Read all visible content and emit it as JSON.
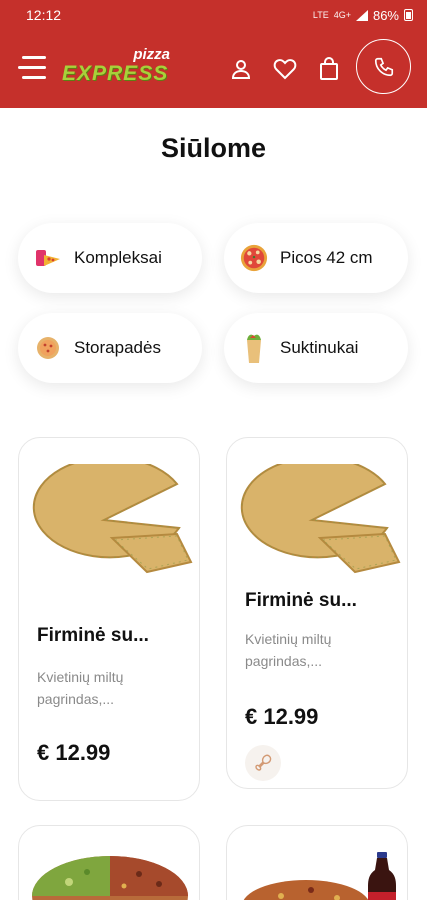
{
  "status_bar": {
    "time": "12:12",
    "network": "LTE",
    "signal_label": "4G+",
    "battery": "86%"
  },
  "header": {
    "logo_small": "pizza",
    "logo_large": "EXPRESS",
    "icons": [
      "menu-icon",
      "user-icon",
      "heart-icon",
      "bag-icon",
      "phone-icon"
    ]
  },
  "section_title": "Siūlome",
  "categories": [
    {
      "label": "Kompleksai",
      "icon": "combo-icon"
    },
    {
      "label": "Picos 42 cm",
      "icon": "pizza-icon"
    },
    {
      "label": "Storapadės",
      "icon": "thick-pizza-icon"
    },
    {
      "label": "Suktinukai",
      "icon": "wrap-icon"
    }
  ],
  "products": [
    {
      "name": "Firminė su...",
      "description": "Kvietinių miltų pagrindas,...",
      "price": "€ 12.99"
    },
    {
      "name": "Firminė su...",
      "description": "Kvietinių miltų pagrindas,...",
      "price": "€ 12.99",
      "tag_icon": "drumstick-icon"
    }
  ],
  "colors": {
    "brand_red": "#c5302b",
    "logo_green": "#a8d13a",
    "muted_text": "#8a8a8a"
  }
}
